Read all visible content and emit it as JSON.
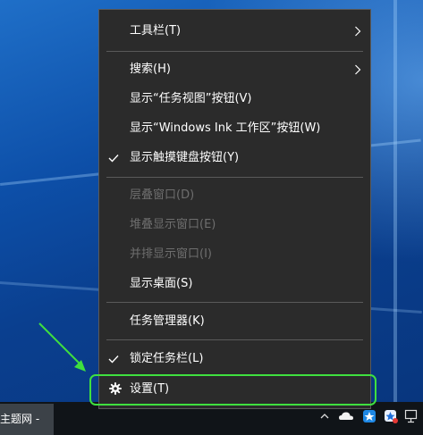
{
  "menu": {
    "toolbars": "工具栏(T)",
    "search": "搜索(H)",
    "show_task_view": "显示“任务视图”按钮(V)",
    "show_ink": "显示“Windows Ink 工作区”按钮(W)",
    "show_touch_keyboard": "显示触摸键盘按钮(Y)",
    "cascade": "层叠窗口(D)",
    "stacked": "堆叠显示窗口(E)",
    "side_by_side": "并排显示窗口(I)",
    "show_desktop": "显示桌面(S)",
    "task_manager": "任务管理器(K)",
    "lock_taskbar": "锁定任务栏(L)",
    "settings": "设置(T)"
  },
  "taskbar": {
    "app_label": "主题网 -"
  },
  "icons": {
    "submenu": "chevron-right-icon",
    "check": "checkmark-icon",
    "settings": "gear-icon",
    "tray": [
      "chevron-up-icon",
      "onedrive-cloud-icon",
      "app-tray-icon",
      "app-tray-icon",
      "network-icon"
    ]
  },
  "colors": {
    "menu_background": "#2b2b2b",
    "menu_text": "#ffffff",
    "disabled_text": "#6e6e6e",
    "highlight_annotation": "#3fe03f"
  }
}
